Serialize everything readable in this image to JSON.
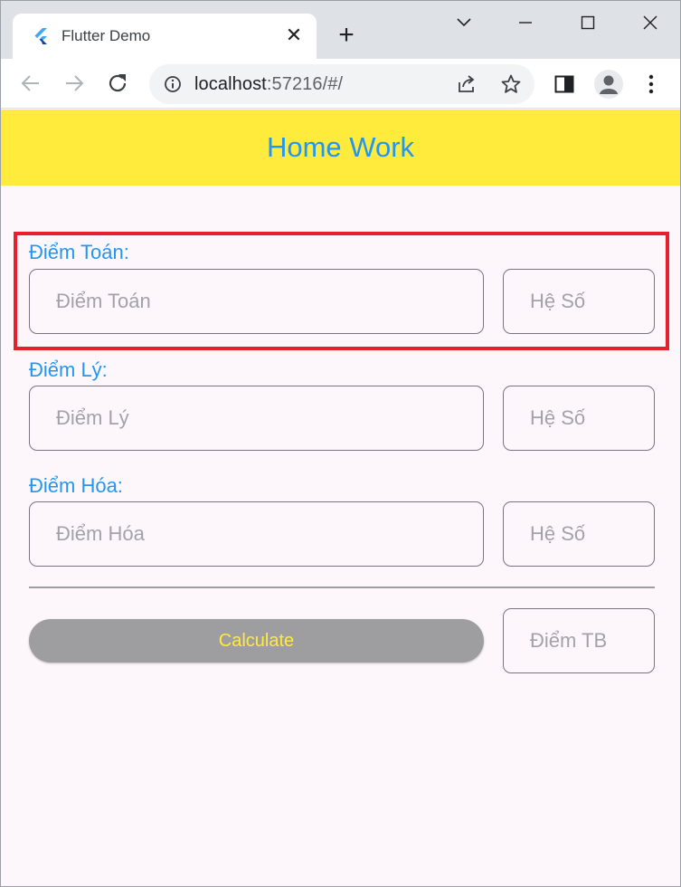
{
  "browser": {
    "tab_title": "Flutter Demo",
    "url_host": "localhost",
    "url_rest": ":57216/#/",
    "icons": [
      "flutter-favicon",
      "close-icon",
      "plus-icon",
      "chevron-down-icon",
      "minimize-icon",
      "maximize-icon",
      "window-close-icon",
      "back-arrow-icon",
      "forward-arrow-icon",
      "reload-icon",
      "info-icon",
      "share-icon",
      "star-icon",
      "side-panel-icon",
      "avatar-icon",
      "kebab-menu-icon"
    ]
  },
  "app": {
    "title": "Home Work",
    "colors": {
      "appbar": "#ffeb3b",
      "accent": "#2196f3",
      "outline": "#79747e",
      "highlight": "#e8202e",
      "button": "#9e9ea1",
      "button_text": "#ffeb3b"
    },
    "fields": [
      {
        "label": "Điểm Toán:",
        "placeholder": "Điểm Toán",
        "coef_placeholder": "Hệ Số"
      },
      {
        "label": "Điểm Lý:",
        "placeholder": "Điểm Lý",
        "coef_placeholder": "Hệ Số"
      },
      {
        "label": "Điểm Hóa:",
        "placeholder": "Điểm Hóa",
        "coef_placeholder": "Hệ Số"
      }
    ],
    "calculate_label": "Calculate",
    "average_placeholder": "Điểm TB"
  }
}
